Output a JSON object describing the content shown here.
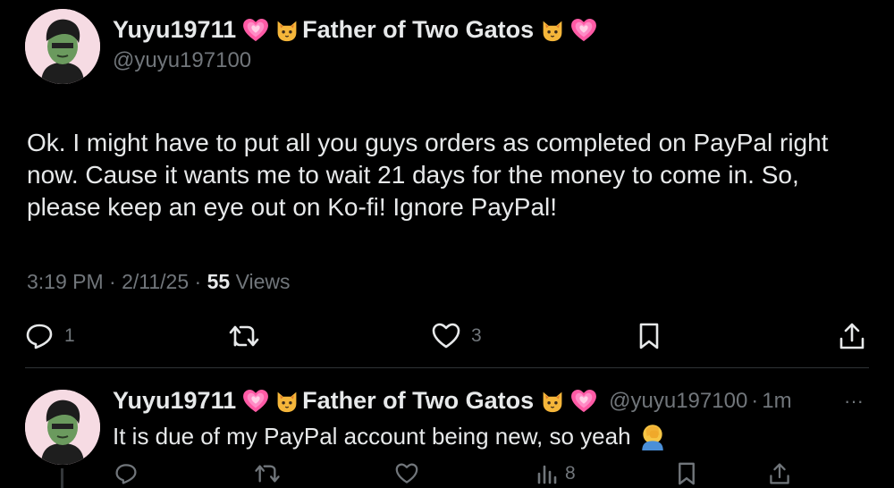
{
  "main_post": {
    "display_name": "Yuyu19711",
    "display_name_suffix": "Father of Two Gatos",
    "handle": "@yuyu197100",
    "text": "Ok. I might have to put all you guys orders as completed on PayPal right now. Cause it wants me to wait 21 days for the money to come in. So, please keep an eye out on Ko-fi! Ignore PayPal!",
    "time": "3:19 PM",
    "date": "2/11/25",
    "views_count": "55",
    "views_label": "Views",
    "reply_count": "1",
    "like_count": "3",
    "icons": [
      "reply-icon",
      "repost-icon",
      "like-icon",
      "bookmark-icon",
      "share-icon"
    ]
  },
  "reply_post": {
    "display_name": "Yuyu19711",
    "display_name_suffix": "Father of Two Gatos",
    "handle": "@yuyu197100",
    "time_ago": "1m",
    "more": "···",
    "text": "It is due of my PayPal account being new, so yeah",
    "views_count": "8",
    "icons": [
      "reply-icon",
      "repost-icon",
      "like-icon",
      "analytics-icon",
      "bookmark-icon",
      "share-icon"
    ]
  },
  "colors": {
    "background": "#000000",
    "text": "#e7e9ea",
    "muted": "#71767b",
    "divider": "#2f3336",
    "heart_emoji": "#ff4f9a",
    "cat_emoji": "#f7b733"
  }
}
